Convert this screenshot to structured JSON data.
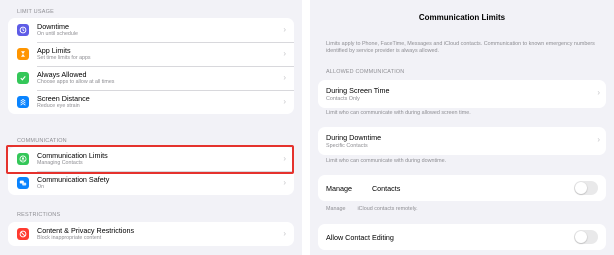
{
  "left": {
    "section_limit_usage": "LIMIT USAGE",
    "section_communication": "COMMUNICATION",
    "section_restrictions": "RESTRICTIONS",
    "items": {
      "downtime": {
        "title": "Downtime",
        "subtitle": "On until schedule",
        "icon": "moon-icon",
        "color": "#5e5ce6"
      },
      "app_limits": {
        "title": "App Limits",
        "subtitle": "Set time limits for apps",
        "icon": "hourglass-icon",
        "color": "#ff9500"
      },
      "always_allowed": {
        "title": "Always Allowed",
        "subtitle": "Choose apps to allow at all times",
        "icon": "checkmark-icon",
        "color": "#34c759"
      },
      "screen_distance": {
        "title": "Screen Distance",
        "subtitle": "Reduce eye strain",
        "icon": "distance-icon",
        "color": "#0a84ff"
      },
      "communication_limits": {
        "title": "Communication Limits",
        "subtitle": "Managing Contacts",
        "icon": "person-bubble-icon",
        "color": "#34c759"
      },
      "communication_safety": {
        "title": "Communication Safety",
        "subtitle": "On",
        "icon": "speech-bubbles-icon",
        "color": "#0a84ff"
      },
      "content_privacy": {
        "title": "Content & Privacy Restrictions",
        "subtitle": "Block inappropriate content",
        "icon": "no-entry-icon",
        "color": "#ff3b30"
      }
    },
    "chevron": "›"
  },
  "right": {
    "title": "Communication Limits",
    "description": "Limits apply to Phone, FaceTime, Messages and iCloud contacts. Communication to known emergency numbers identified by        service provider is always allowed.",
    "section_allowed": "ALLOWED COMMUNICATION",
    "during_screen_time": {
      "title": "During Screen Time",
      "subtitle": "Contacts Only",
      "footer": "Limit who      can communicate with during allowed screen time."
    },
    "during_downtime": {
      "title": "During Downtime",
      "subtitle": "Specific Contacts",
      "footer": "Limit who      can communicate with during downtime."
    },
    "manage_contacts": {
      "title": "Manage          Contacts",
      "footer": "Manage        iCloud contacts remotely.",
      "enabled": false
    },
    "allow_contact_editing": {
      "title": "Allow Contact Editing",
      "enabled": false
    },
    "chevron": "›"
  }
}
